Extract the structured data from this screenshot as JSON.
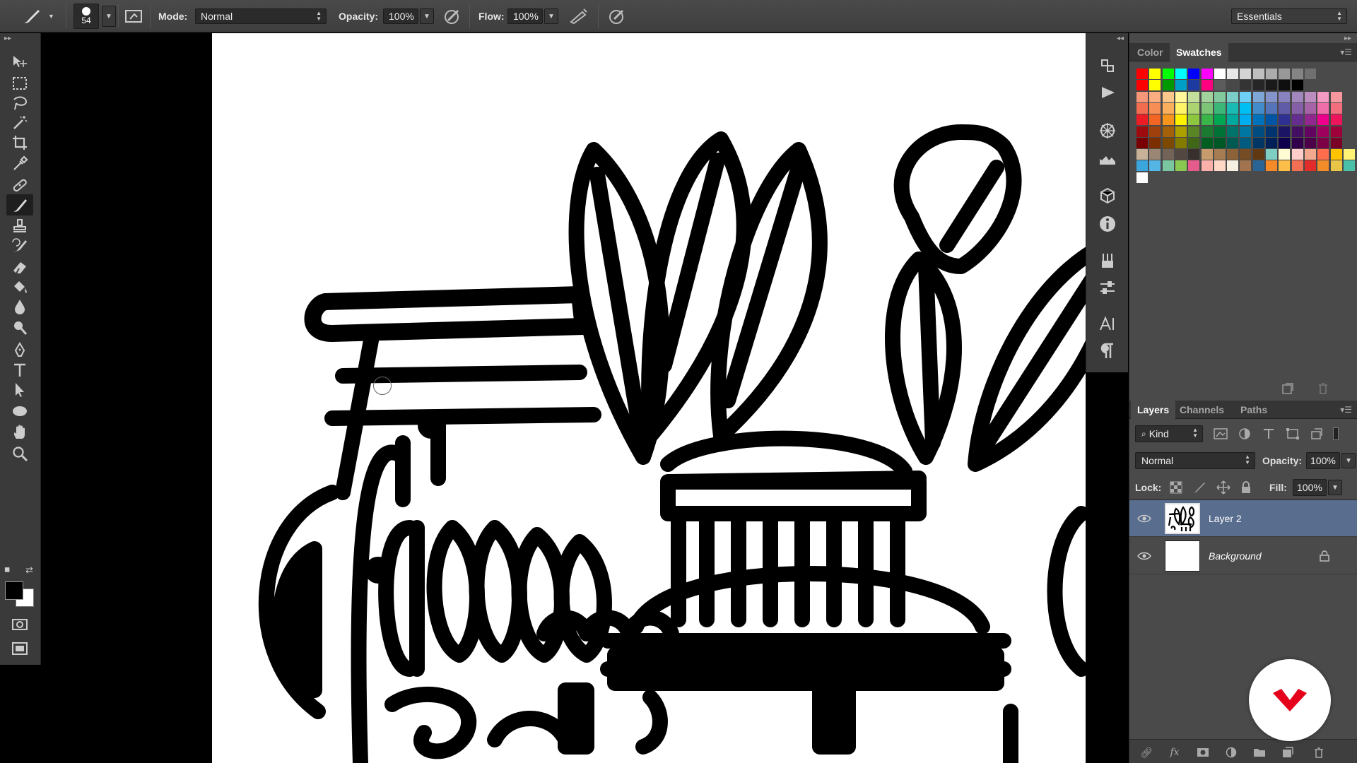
{
  "options_bar": {
    "brush_size": "54",
    "mode_label": "Mode:",
    "mode_value": "Normal",
    "opacity_label": "Opacity:",
    "opacity_value": "100%",
    "flow_label": "Flow:",
    "flow_value": "100%",
    "workspace": "Essentials"
  },
  "tools": [
    {
      "name": "move-tool",
      "icon": "move-icon"
    },
    {
      "name": "marquee-tool",
      "icon": "marquee-icon"
    },
    {
      "name": "lasso-tool",
      "icon": "lasso-icon"
    },
    {
      "name": "magic-wand-tool",
      "icon": "magic-wand-icon"
    },
    {
      "name": "crop-tool",
      "icon": "crop-icon"
    },
    {
      "name": "eyedropper-tool",
      "icon": "eyedropper-icon"
    },
    {
      "name": "healing-brush-tool",
      "icon": "bandage-icon"
    },
    {
      "name": "brush-tool",
      "icon": "brush-icon",
      "active": true
    },
    {
      "name": "clone-stamp-tool",
      "icon": "stamp-icon"
    },
    {
      "name": "history-brush-tool",
      "icon": "history-brush-icon"
    },
    {
      "name": "eraser-tool",
      "icon": "eraser-icon"
    },
    {
      "name": "paint-bucket-tool",
      "icon": "bucket-icon"
    },
    {
      "name": "blur-tool",
      "icon": "drop-icon"
    },
    {
      "name": "dodge-tool",
      "icon": "dodge-icon"
    },
    {
      "name": "pen-tool",
      "icon": "pen-icon"
    },
    {
      "name": "type-tool",
      "icon": "type-icon"
    },
    {
      "name": "path-selection-tool",
      "icon": "arrow-icon"
    },
    {
      "name": "shape-tool",
      "icon": "ellipse-icon"
    },
    {
      "name": "hand-tool",
      "icon": "hand-icon"
    },
    {
      "name": "zoom-tool",
      "icon": "zoom-icon"
    }
  ],
  "colors": {
    "foreground": "#000000",
    "background": "#ffffff",
    "accent_red": "#e5001b",
    "layer_selected": "#596d8e"
  },
  "swatches_panel": {
    "tabs": [
      "Color",
      "Swatches"
    ],
    "active_tab": "Swatches"
  },
  "layers_panel": {
    "tabs": [
      "Layers",
      "Channels",
      "Paths"
    ],
    "active_tab": "Layers",
    "filter_value": "Kind",
    "blend_mode": "Normal",
    "opacity_label": "Opacity:",
    "opacity_value": "100%",
    "lock_label": "Lock:",
    "fill_label": "Fill:",
    "fill_value": "100%",
    "layers": [
      {
        "name": "Layer 2",
        "selected": true,
        "visible": true,
        "locked": false
      },
      {
        "name": "Background",
        "selected": false,
        "visible": true,
        "locked": true
      }
    ]
  }
}
